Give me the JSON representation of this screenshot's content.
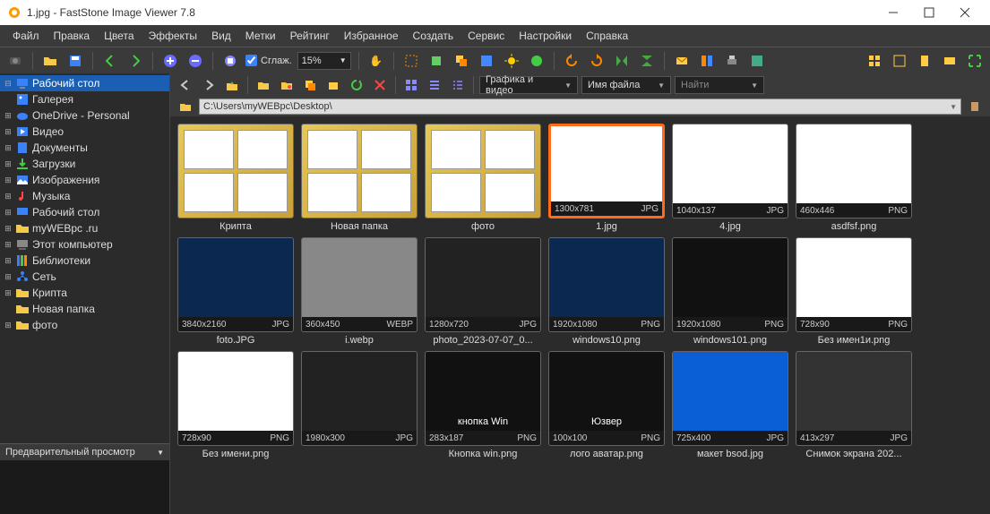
{
  "title": "1.jpg  -  FastStone Image Viewer 7.8",
  "menu": [
    "Файл",
    "Правка",
    "Цвета",
    "Эффекты",
    "Вид",
    "Метки",
    "Рейтинг",
    "Избранное",
    "Создать",
    "Сервис",
    "Настройки",
    "Справка"
  ],
  "smooth_label": "Сглаж.",
  "zoom": "15%",
  "tree": [
    {
      "label": "Рабочий стол",
      "icon": "desktop",
      "sel": true,
      "exp": "-"
    },
    {
      "label": "Галерея",
      "icon": "gallery",
      "exp": ""
    },
    {
      "label": "OneDrive - Personal",
      "icon": "onedrive",
      "exp": "+"
    },
    {
      "label": "Видео",
      "icon": "video",
      "exp": "+"
    },
    {
      "label": "Документы",
      "icon": "docs",
      "exp": "+"
    },
    {
      "label": "Загрузки",
      "icon": "download",
      "exp": "+"
    },
    {
      "label": "Изображения",
      "icon": "images",
      "exp": "+"
    },
    {
      "label": "Музыка",
      "icon": "music",
      "exp": "+"
    },
    {
      "label": "Рабочий стол",
      "icon": "desktop2",
      "exp": "+"
    },
    {
      "label": "myWEBpc .ru",
      "icon": "folder",
      "exp": "+"
    },
    {
      "label": "Этот компьютер",
      "icon": "computer",
      "exp": "+"
    },
    {
      "label": "Библиотеки",
      "icon": "libs",
      "exp": "+"
    },
    {
      "label": "Сеть",
      "icon": "network",
      "exp": "+"
    },
    {
      "label": "Крипта",
      "icon": "folder",
      "exp": "+"
    },
    {
      "label": "Новая папка",
      "icon": "folder",
      "exp": ""
    },
    {
      "label": "фото",
      "icon": "folder",
      "exp": "+"
    }
  ],
  "preview_label": "Предварительный просмотр",
  "sort1": "Графика и видео",
  "sort2": "Имя файла",
  "search": "Найти",
  "path": "C:\\Users\\myWEBpc\\Desktop\\",
  "rows": [
    [
      {
        "type": "folder",
        "name": "Крипта"
      },
      {
        "type": "folder",
        "name": "Новая папка"
      },
      {
        "type": "folder",
        "name": "фото"
      },
      {
        "type": "file",
        "name": "1.jpg",
        "dim": "1300x781",
        "ext": "JPG",
        "sel": true,
        "bg": "#fff"
      },
      {
        "type": "file",
        "name": "4.jpg",
        "dim": "1040x137",
        "ext": "JPG",
        "bg": "#fff"
      },
      {
        "type": "file",
        "name": "asdfsf.png",
        "dim": "460x446",
        "ext": "PNG",
        "bg": "#fff"
      }
    ],
    [
      {
        "type": "file",
        "name": "foto.JPG",
        "dim": "3840x2160",
        "ext": "JPG",
        "bg": "#0a2850"
      },
      {
        "type": "file",
        "name": "i.webp",
        "dim": "360x450",
        "ext": "WEBP",
        "bg": "#888"
      },
      {
        "type": "file",
        "name": "photo_2023-07-07_0...",
        "dim": "1280x720",
        "ext": "JPG",
        "bg": "#222"
      },
      {
        "type": "file",
        "name": "windows10.png",
        "dim": "1920x1080",
        "ext": "PNG",
        "bg": "#0a2850"
      },
      {
        "type": "file",
        "name": "windows101.png",
        "dim": "1920x1080",
        "ext": "PNG",
        "bg": "#111"
      },
      {
        "type": "file",
        "name": "Без имен1и.png",
        "dim": "728x90",
        "ext": "PNG",
        "bg": "#fff"
      }
    ],
    [
      {
        "type": "file",
        "name": "Без имени.png",
        "dim": "728x90",
        "ext": "PNG",
        "bg": "#fff"
      },
      {
        "type": "file",
        "name": "",
        "dim": "1980x300",
        "ext": "JPG",
        "bg": "#222"
      },
      {
        "type": "file",
        "name": "Кнопка win.png",
        "dim": "283x187",
        "ext": "PNG",
        "bg": "#111",
        "label": "кнопка Win"
      },
      {
        "type": "file",
        "name": "лого аватар.png",
        "dim": "100x100",
        "ext": "PNG",
        "bg": "#111",
        "label": "Юзвер"
      },
      {
        "type": "file",
        "name": "макет bsod.jpg",
        "dim": "725x400",
        "ext": "JPG",
        "bg": "#0a5fd6"
      },
      {
        "type": "file",
        "name": "Снимок экрана 202...",
        "dim": "413x297",
        "ext": "JPG",
        "bg": "#333"
      }
    ]
  ]
}
